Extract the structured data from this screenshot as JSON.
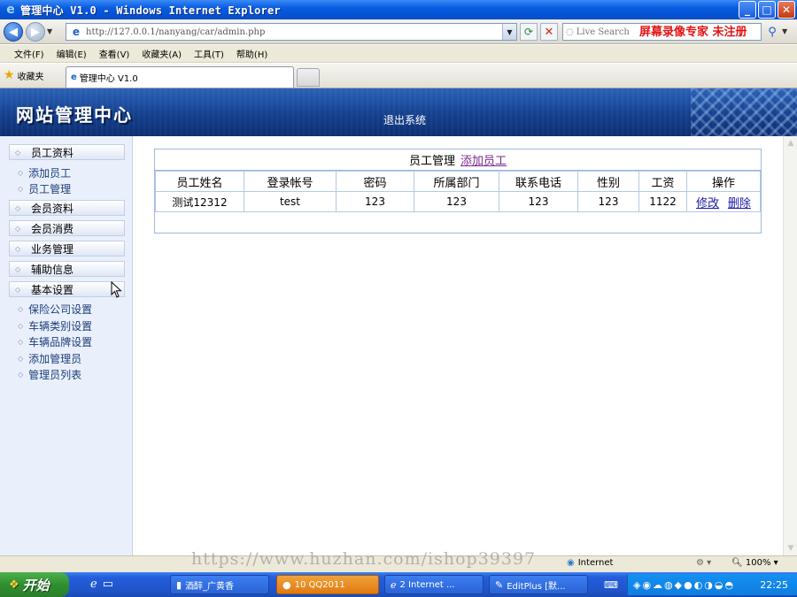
{
  "window": {
    "title": "管理中心 V1.0 - Windows Internet Explorer",
    "controls": {
      "minimize": "_",
      "maximize": "□",
      "close": "✕"
    }
  },
  "address_bar": {
    "url": "http://127.0.0.1/nanyang/car/admin.php",
    "search_placeholder": "Live Search"
  },
  "overlay_watermark": "屏幕录像专家 未注册",
  "menu": [
    "文件(F)",
    "编辑(E)",
    "查看(V)",
    "收藏夹(A)",
    "工具(T)",
    "帮助(H)"
  ],
  "favorites_label": "收藏夹",
  "tab": {
    "label": "管理中心 V1.0"
  },
  "header": {
    "site_title": "网站管理中心",
    "logout": "退出系统"
  },
  "sidebar": {
    "groups": [
      {
        "label": "员工资料",
        "links": [
          "添加员工",
          "员工管理"
        ]
      },
      {
        "label": "会员资料",
        "links": []
      },
      {
        "label": "会员消费",
        "links": []
      },
      {
        "label": "业务管理",
        "links": []
      },
      {
        "label": "辅助信息",
        "links": []
      },
      {
        "label": "基本设置",
        "links": [
          "保险公司设置",
          "车辆类别设置",
          "车辆品牌设置",
          "添加管理员",
          "管理员列表"
        ]
      }
    ]
  },
  "panel": {
    "title": "员工管理",
    "add_link": "添加员工",
    "columns": [
      "员工姓名",
      "登录帐号",
      "密码",
      "所属部门",
      "联系电话",
      "性别",
      "工资",
      "操作"
    ],
    "rows": [
      {
        "name": "测试12312",
        "account": "test",
        "password": "123",
        "department": "123",
        "phone": "123",
        "gender": "123",
        "salary": "1122",
        "edit": "修改",
        "delete": "删除"
      }
    ]
  },
  "status_bar": {
    "watermark": "https://www.huzhan.com/ishop39397",
    "zone": "Internet",
    "zoom": "100%"
  },
  "taskbar": {
    "start": "开始",
    "tasks": [
      {
        "label": "酒醉_广黄香"
      },
      {
        "label": "10 QQ2011"
      },
      {
        "label": "2 Internet ..."
      },
      {
        "label": "EditPlus [默..."
      }
    ],
    "clock": "22:25"
  }
}
